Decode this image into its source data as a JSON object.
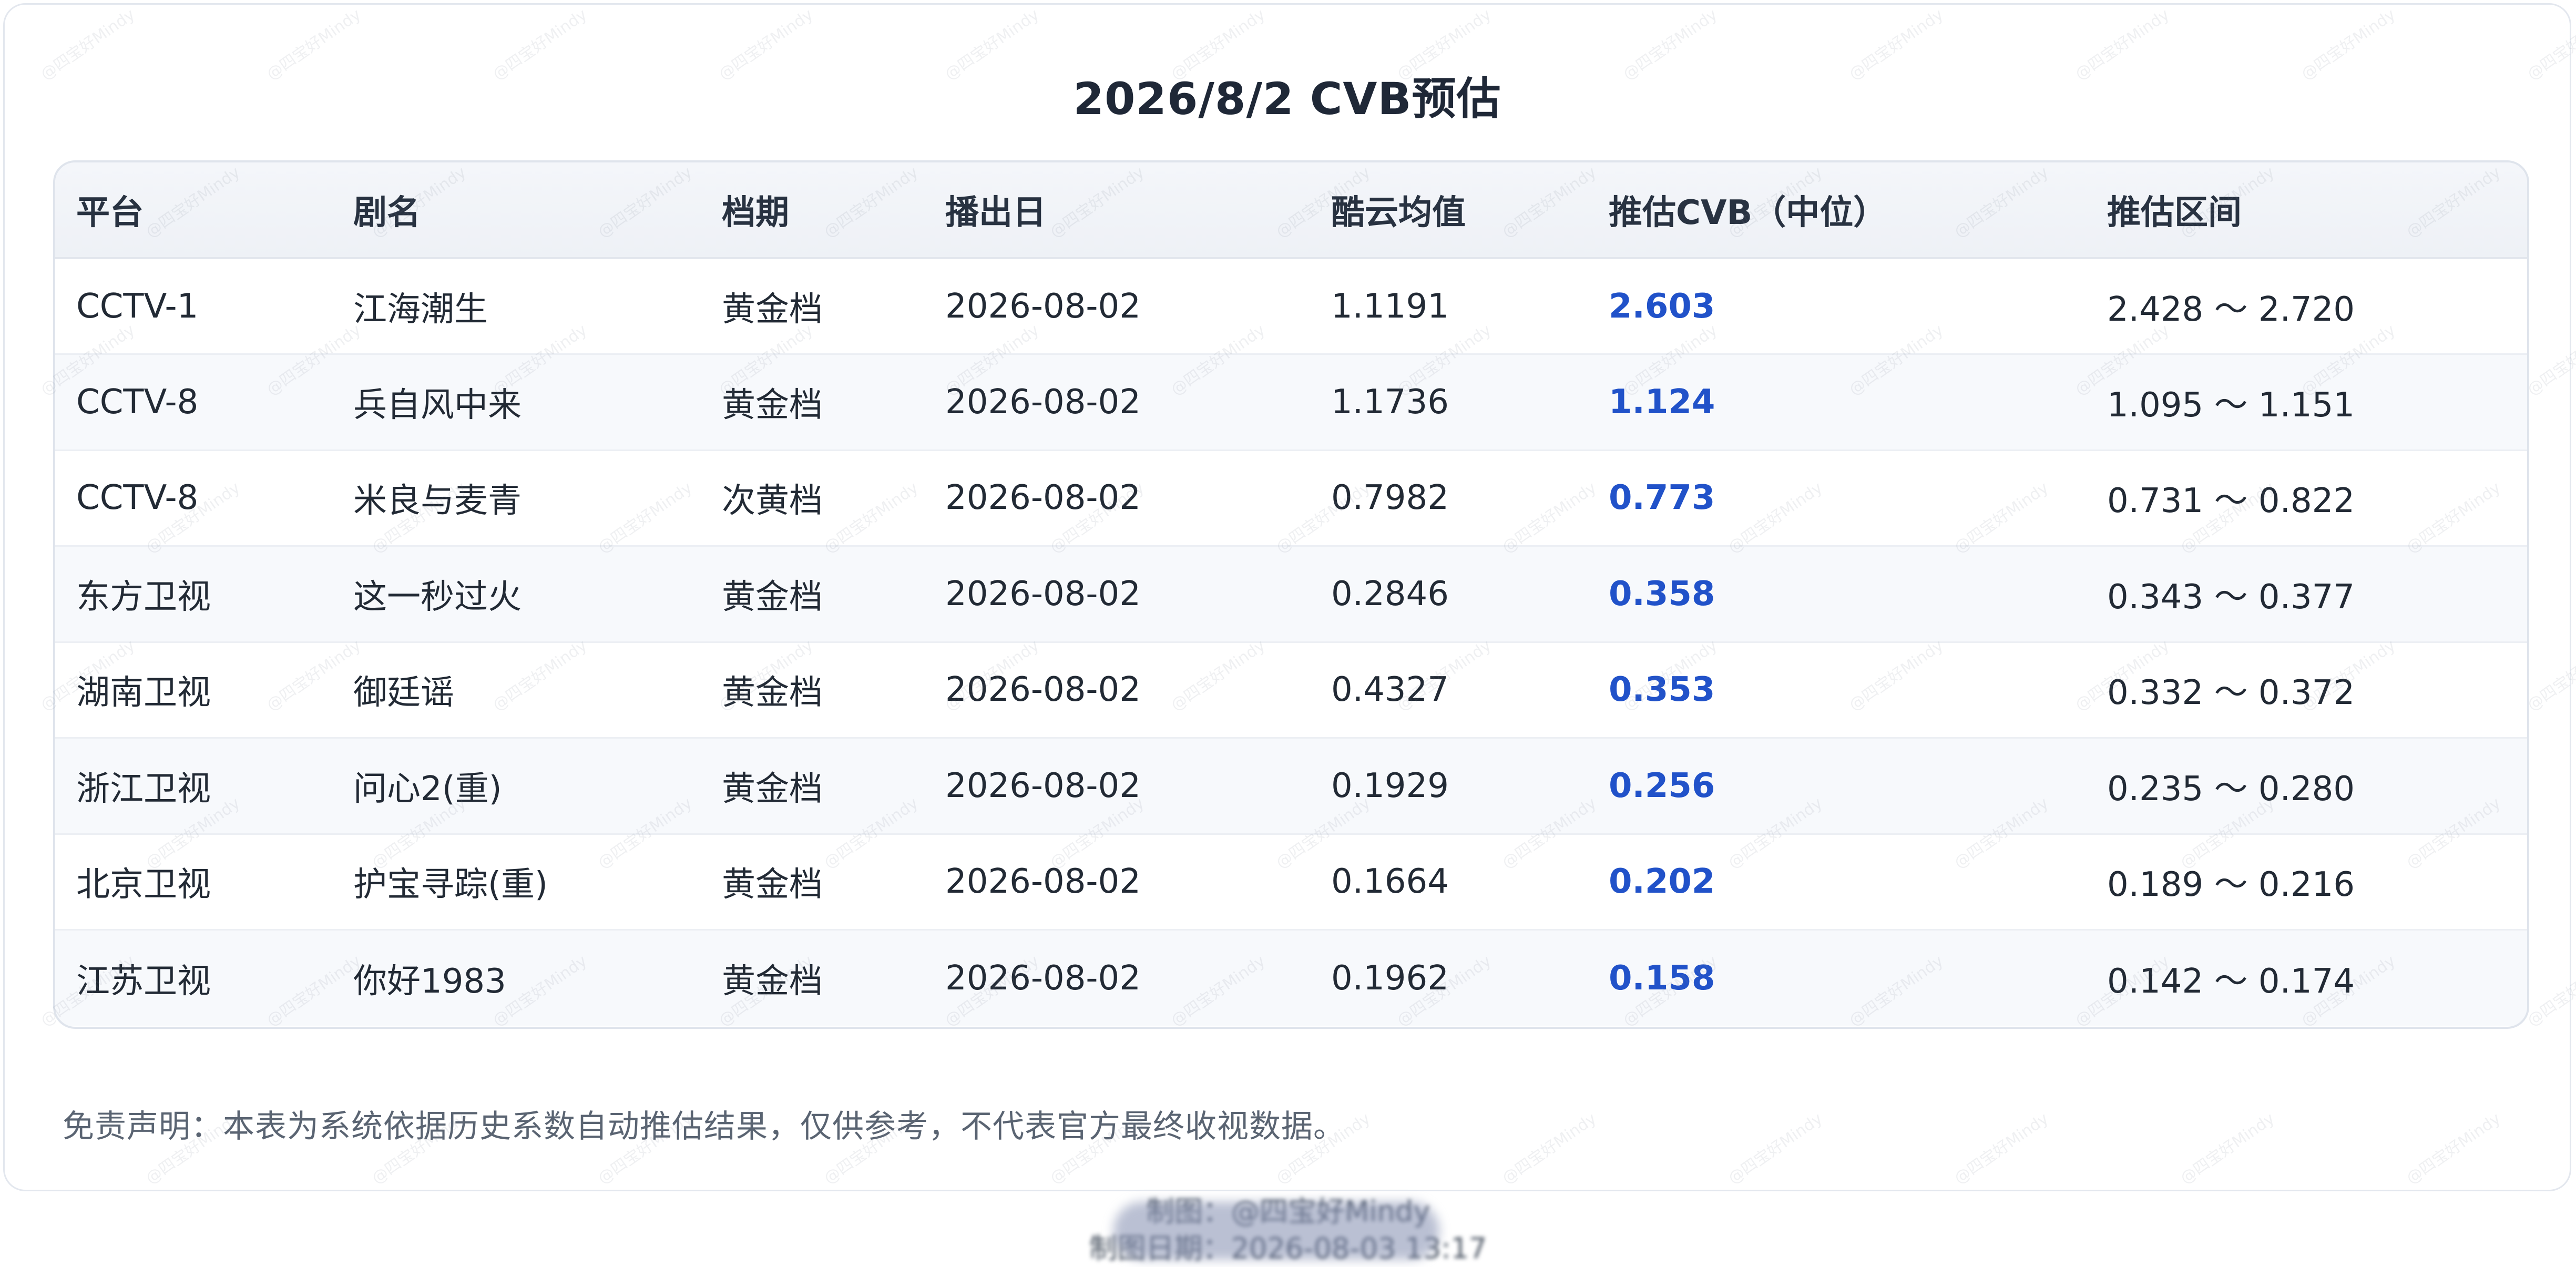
{
  "title": "2026/8/2 CVB预估",
  "table": {
    "headers": [
      "平台",
      "剧名",
      "档期",
      "播出日",
      "酷云均值",
      "推估CVB（中位）",
      "推估区间"
    ],
    "rows": [
      [
        "CCTV-1",
        "江海潮生",
        "黄金档",
        "2026-08-02",
        "1.1191",
        "2.603",
        "2.428 ～ 2.720"
      ],
      [
        "CCTV-8",
        "兵自风中来",
        "黄金档",
        "2026-08-02",
        "1.1736",
        "1.124",
        "1.095 ～ 1.151"
      ],
      [
        "CCTV-8",
        "米良与麦青",
        "次黄档",
        "2026-08-02",
        "0.7982",
        "0.773",
        "0.731 ～ 0.822"
      ],
      [
        "东方卫视",
        "这一秒过火",
        "黄金档",
        "2026-08-02",
        "0.2846",
        "0.358",
        "0.343 ～ 0.377"
      ],
      [
        "湖南卫视",
        "御廷谣",
        "黄金档",
        "2026-08-02",
        "0.4327",
        "0.353",
        "0.332 ～ 0.372"
      ],
      [
        "浙江卫视",
        "问心2(重)",
        "黄金档",
        "2026-08-02",
        "0.1929",
        "0.256",
        "0.235 ～ 0.280"
      ],
      [
        "北京卫视",
        "护宝寻踪(重)",
        "黄金档",
        "2026-08-02",
        "0.1664",
        "0.202",
        "0.189 ～ 0.216"
      ],
      [
        "江苏卫视",
        "你好1983",
        "黄金档",
        "2026-08-02",
        "0.1962",
        "0.158",
        "0.142 ～ 0.174"
      ]
    ]
  },
  "disclaimer": "免责声明：本表为系统依据历史系数自动推估结果，仅供参考，不代表官方最终收视数据。",
  "footer": {
    "line1": "制图：@四宝好Mindy",
    "line2": "制图日期：2026-08-03 13:17"
  },
  "colors": {
    "cvb_value": "#2152c9",
    "header_bg": "#f2f4f8",
    "border": "#dfe4ec"
  }
}
